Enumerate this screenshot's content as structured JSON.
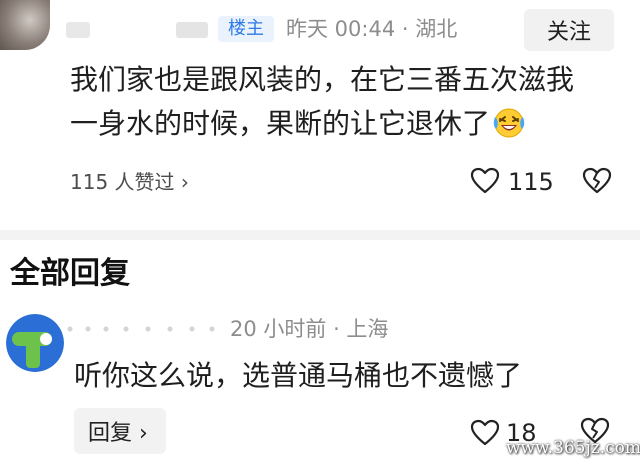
{
  "top_comment": {
    "badge": "楼主",
    "meta": "昨天 00:44 · 湖北",
    "follow_label": "关注",
    "text_line1": "我们家也是跟风装的，在它三番五次滋我",
    "text_line2": "一身水的时候，果断的让它退休了",
    "emoji": "laughing-crying-emoji",
    "likes_text": "115 人赞过",
    "likes_chevron": "›",
    "like_count": "115"
  },
  "section": {
    "title": "全部回复"
  },
  "reply": {
    "meta": "20 小时前 · 上海",
    "text": "听你这么说，选普通马桶也不遗憾了",
    "reply_label": "回复 ›",
    "like_count": "18"
  },
  "watermark": "www.365jz.com",
  "colors": {
    "badge_blue": "#2f7ae5",
    "badge_bg": "#e9f2fd",
    "meta_gray": "#8d8d8d",
    "avatar_reply_blue": "#2b6fd6",
    "avatar_reply_green": "#6cc24a"
  }
}
